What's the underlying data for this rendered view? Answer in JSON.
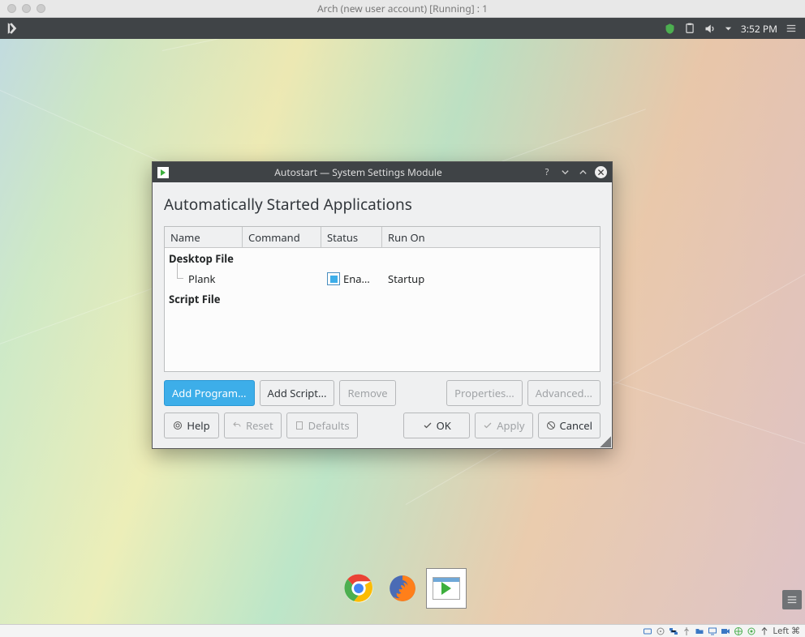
{
  "vm": {
    "title": "Arch (new user account) [Running] : 1",
    "status_right": "Left ⌘"
  },
  "panel": {
    "clock": "3:52 PM"
  },
  "dialog": {
    "title": "Autostart — System Settings Module",
    "heading": "Automatically Started Applications",
    "columns": {
      "name": "Name",
      "command": "Command",
      "status": "Status",
      "runon": "Run On"
    },
    "groups": {
      "desktop": "Desktop File",
      "script": "Script File"
    },
    "entries": [
      {
        "name": "Plank",
        "status_label": "Ena…",
        "runon": "Startup"
      }
    ],
    "buttons": {
      "add_program": "Add Program...",
      "add_script": "Add Script...",
      "remove": "Remove",
      "properties": "Properties...",
      "advanced": "Advanced...",
      "help": "Help",
      "reset": "Reset",
      "defaults": "Defaults",
      "ok": "OK",
      "apply": "Apply",
      "cancel": "Cancel"
    }
  },
  "dock": {
    "items": [
      "chrome",
      "firefox",
      "system-settings"
    ]
  }
}
